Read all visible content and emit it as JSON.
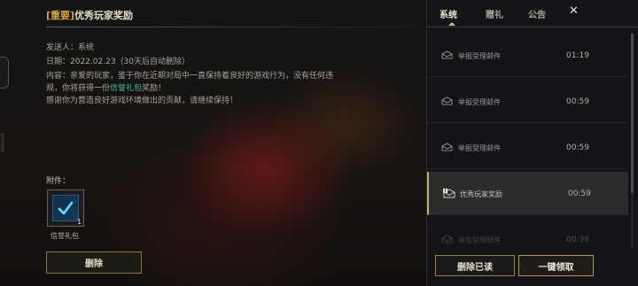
{
  "mail": {
    "tag": "[重要]",
    "title": "优秀玩家奖励",
    "sender_label": "发送人：",
    "sender": "系统",
    "date_label": "日期：",
    "date": "2022.02.23",
    "expiry": "（30天后自动删除）",
    "content_prefix": "内容：亲爱的玩家，鉴于你在近期对局中一直保持着良好的游戏行为，没有任何违规，你将获得一份",
    "content_highlight": "信誉礼包",
    "content_suffix": "奖励！",
    "content_line2": "感谢你为营造良好游戏环境做出的贡献，请继续保持！",
    "attachment_label": "附件：",
    "attachment": {
      "name": "信誉礼包",
      "count": "1",
      "icon": "check-gift-icon"
    },
    "delete_label": "删除"
  },
  "tabs": [
    {
      "label": "系统",
      "active": true
    },
    {
      "label": "赠礼",
      "active": false
    },
    {
      "label": "公告",
      "active": false
    }
  ],
  "close_symbol": "✕",
  "mail_list": [
    {
      "subject": "举报受理邮件",
      "time": "01:19",
      "icon": "envelope-open-icon",
      "selected": false
    },
    {
      "subject": "举报受理邮件",
      "time": "00:59",
      "icon": "envelope-open-icon",
      "selected": false
    },
    {
      "subject": "举报受理邮件",
      "time": "00:59",
      "icon": "envelope-open-icon",
      "selected": false
    },
    {
      "subject": "优秀玩家奖励",
      "time": "00:59",
      "icon": "envelope-important-icon",
      "selected": true
    },
    {
      "subject": "举报受理邮件",
      "time": "00:39",
      "icon": "envelope-open-icon",
      "selected": false
    }
  ],
  "actions": {
    "delete_read_label": "删除已读",
    "claim_all_label": "一键领取"
  },
  "colors": {
    "accent_gold": "#c9ad6a",
    "tag_orange": "#d9a13a",
    "highlight_teal": "#45b89a"
  }
}
